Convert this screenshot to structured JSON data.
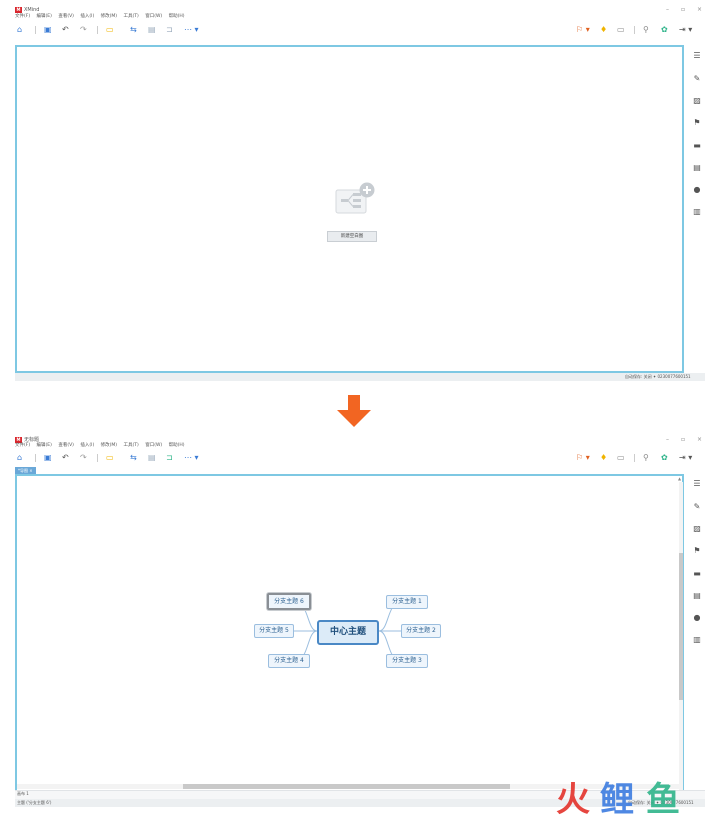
{
  "top": {
    "app_title": "XMind",
    "menu": [
      "文件(F)",
      "编辑(E)",
      "查看(V)",
      "插入(I)",
      "修改(M)",
      "工具(T)",
      "窗口(W)",
      "帮助(H)"
    ],
    "empty_button": "新建空白图",
    "status": "自动保存: 关闭  ✦ 0230077600151"
  },
  "bottom": {
    "app_title": "无标题",
    "menu": [
      "文件(F)",
      "编辑(E)",
      "查看(V)",
      "插入(I)",
      "修改(M)",
      "工具(T)",
      "窗口(W)",
      "帮助(H)"
    ],
    "tab_label": "*导图 ×",
    "central_topic": "中心主题",
    "subtopics": [
      "分支主题 1",
      "分支主题 2",
      "分支主题 3",
      "分支主题 4",
      "分支主题 5",
      "分支主题 6"
    ],
    "outline_label": "画布 1",
    "selection_status": "主题 ('分支主题 6')",
    "status_right": "自动保存: 关闭 ✦ 0230077600151"
  },
  "watermark": {
    "chars": [
      "火",
      "鲤",
      "鱼"
    ],
    "colors": [
      "#e4322b",
      "#3c7ce0",
      "#2fb48a"
    ]
  },
  "arrow_color": "#f26522"
}
